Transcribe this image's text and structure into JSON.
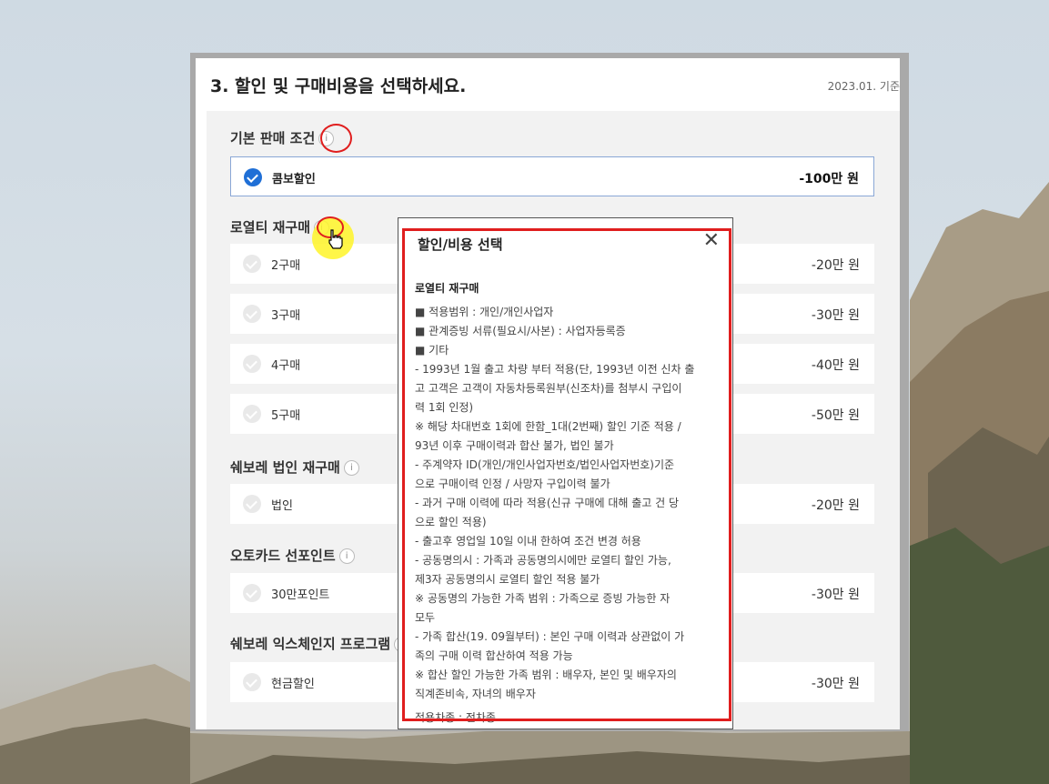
{
  "page": {
    "title": "3. 할인 및 구매비용을 선택하세요.",
    "date_note": "2023.01. 기준"
  },
  "sections": [
    {
      "title": "기본 판매 조건",
      "items": [
        {
          "label": "콤보할인",
          "price": "-100만 원",
          "selected": true
        }
      ]
    },
    {
      "title": "로열티 재구매",
      "items": [
        {
          "label": "2구매",
          "price": "-20만 원",
          "selected": false
        },
        {
          "label": "3구매",
          "price": "-30만 원",
          "selected": false
        },
        {
          "label": "4구매",
          "price": "-40만 원",
          "selected": false
        },
        {
          "label": "5구매",
          "price": "-50만 원",
          "selected": false
        }
      ]
    },
    {
      "title": "쉐보레 법인 재구매",
      "items": [
        {
          "label": "법인",
          "price": "-20만 원",
          "selected": false
        }
      ]
    },
    {
      "title": "오토카드 선포인트",
      "items": [
        {
          "label": "30만포인트",
          "price": "-30만 원",
          "selected": false
        }
      ]
    },
    {
      "title": "쉐보레 익스체인지 프로그램",
      "items": [
        {
          "label": "현금할인",
          "price": "-30만 원",
          "selected": false
        }
      ]
    }
  ],
  "icons": {
    "info": "info-icon",
    "check": "check-icon",
    "close": "close-icon",
    "cursor": "hand-cursor-icon"
  },
  "modal": {
    "title": "할인/비용 선택",
    "close": "✕",
    "subtitle": "로열티 재구매",
    "lines": [
      "■ 적용범위 : 개인/개인사업자",
      "■ 관계증빙 서류(필요시/사본) : 사업자등록증",
      "■ 기타",
      "- 1993년 1월 출고 차량 부터 적용(단, 1993년 이전 신차 출",
      "고 고객은 고객이 자동차등록원부(신조차)를 첨부시 구입이",
      "력 1회 인정)",
      "※ 해당 차대번호 1회에 한함_1대(2번째) 할인 기준 적용 /",
      "93년 이후 구매이력과 합산 불가, 법인 불가",
      "- 주계약자 ID(개인/개인사업자번호/법인사업자번호)기준",
      "으로 구매이력 인정 / 사망자 구입이력 불가",
      "- 과거 구매 이력에 따라 적용(신규 구매에 대해 출고 건 당",
      "으로 할인 적용)",
      "- 출고후 영업일 10일 이내 한하여 조건 변경 허용",
      "- 공동명의시 : 가족과 공동명의시에만 로열티 할인 가능,",
      "제3자 공동명의시 로열티 할인 적용 불가",
      "※ 공동명의 가능한 가족 범위 : 가족으로 증빙 가능한 자",
      "모두",
      "- 가족 합산(19. 09월부터) : 본인 구매 이력과 상관없이 가",
      "족의 구매 이력 합산하여 적용 가능",
      "※ 합산 할인 가능한 가족 범위 : 배우자, 본인 및 배우자의",
      "직계존비속, 자녀의 배우자"
    ],
    "footer": "적용차종 : 전차종"
  },
  "colors": {
    "accent": "#1f6fd6",
    "highlight": "#e01e1e",
    "cursor_halo": "#fff528"
  }
}
